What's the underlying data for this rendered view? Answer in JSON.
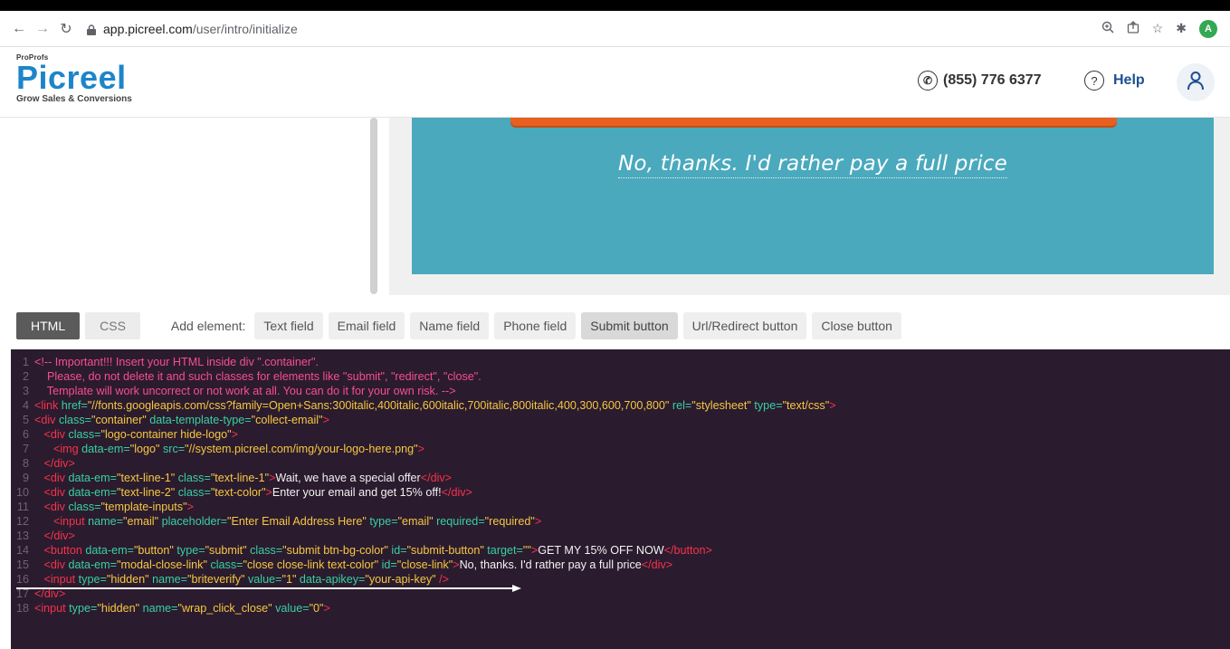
{
  "browser": {
    "url_host": "app.picreel.com",
    "url_path": "/user/intro/initialize",
    "profile_initial": "A"
  },
  "header": {
    "brand_small": "ProProfs",
    "brand_name": "Picreel",
    "brand_tagline": "Grow Sales & Conversions",
    "phone": "(855) 776 6377",
    "help_label": "Help"
  },
  "preview": {
    "decline_text": "No, thanks. I'd rather pay a full price"
  },
  "toolbar": {
    "tabs": [
      {
        "label": "HTML",
        "active": true
      },
      {
        "label": "CSS",
        "active": false
      }
    ],
    "add_element_label": "Add element:",
    "elements": [
      "Text field",
      "Email field",
      "Name field",
      "Phone field",
      "Submit button",
      "Url/Redirect button",
      "Close button"
    ]
  },
  "code": {
    "lines": [
      [
        [
          "cmt",
          "<!-- Important!!! Insert your HTML inside div \".container\"."
        ]
      ],
      [
        [
          "cmt",
          "    Please, do not delete it and such classes for elements like \"submit\", \"redirect\", \"close\"."
        ]
      ],
      [
        [
          "cmt",
          "    Template will work uncorrect or not work at all. You can do it for your own risk. -->"
        ]
      ],
      [
        [
          "tag",
          "<link "
        ],
        [
          "attr",
          "href="
        ],
        [
          "val",
          "\"//fonts.googleapis.com/css?family=Open+Sans:300italic,400italic,600italic,700italic,800italic,400,300,600,700,800\""
        ],
        [
          "attr",
          " rel="
        ],
        [
          "val",
          "\"stylesheet\""
        ],
        [
          "attr",
          " type="
        ],
        [
          "val",
          "\"text/css\""
        ],
        [
          "tag",
          ">"
        ]
      ],
      [
        [
          "tag",
          "<div "
        ],
        [
          "attr",
          "class="
        ],
        [
          "val",
          "\"container\""
        ],
        [
          "attr",
          " data-template-type="
        ],
        [
          "val",
          "\"collect-email\""
        ],
        [
          "tag",
          ">"
        ]
      ],
      [
        [
          "txt",
          "   "
        ],
        [
          "tag",
          "<div "
        ],
        [
          "attr",
          "class="
        ],
        [
          "val",
          "\"logo-container hide-logo\""
        ],
        [
          "tag",
          ">"
        ]
      ],
      [
        [
          "txt",
          "      "
        ],
        [
          "tag",
          "<img "
        ],
        [
          "attr",
          "data-em="
        ],
        [
          "val",
          "\"logo\""
        ],
        [
          "attr",
          " src="
        ],
        [
          "val",
          "\"//system.picreel.com/img/your-logo-here.png\""
        ],
        [
          "tag",
          ">"
        ]
      ],
      [
        [
          "txt",
          "   "
        ],
        [
          "tag",
          "</div>"
        ]
      ],
      [
        [
          "txt",
          "   "
        ],
        [
          "tag",
          "<div "
        ],
        [
          "attr",
          "data-em="
        ],
        [
          "val",
          "\"text-line-1\""
        ],
        [
          "attr",
          " class="
        ],
        [
          "val",
          "\"text-line-1\""
        ],
        [
          "tag",
          ">"
        ],
        [
          "txt",
          "Wait, we have a special offer"
        ],
        [
          "tag",
          "</div>"
        ]
      ],
      [
        [
          "txt",
          "   "
        ],
        [
          "tag",
          "<div "
        ],
        [
          "attr",
          "data-em="
        ],
        [
          "val",
          "\"text-line-2\""
        ],
        [
          "attr",
          " class="
        ],
        [
          "val",
          "\"text-color\""
        ],
        [
          "tag",
          ">"
        ],
        [
          "txt",
          "Enter your email and get 15% off!"
        ],
        [
          "tag",
          "</div>"
        ]
      ],
      [
        [
          "txt",
          "   "
        ],
        [
          "tag",
          "<div "
        ],
        [
          "attr",
          "class="
        ],
        [
          "val",
          "\"template-inputs\""
        ],
        [
          "tag",
          ">"
        ]
      ],
      [
        [
          "txt",
          "      "
        ],
        [
          "tag",
          "<input "
        ],
        [
          "attr",
          "name="
        ],
        [
          "val",
          "\"email\""
        ],
        [
          "attr",
          " placeholder="
        ],
        [
          "val",
          "\"Enter Email Address Here\""
        ],
        [
          "attr",
          " type="
        ],
        [
          "val",
          "\"email\""
        ],
        [
          "attr",
          " required="
        ],
        [
          "val",
          "\"required\""
        ],
        [
          "tag",
          ">"
        ]
      ],
      [
        [
          "txt",
          "   "
        ],
        [
          "tag",
          "</div>"
        ]
      ],
      [
        [
          "txt",
          "   "
        ],
        [
          "tag",
          "<button "
        ],
        [
          "attr",
          "data-em="
        ],
        [
          "val",
          "\"button\""
        ],
        [
          "attr",
          " type="
        ],
        [
          "val",
          "\"submit\""
        ],
        [
          "attr",
          " class="
        ],
        [
          "val",
          "\"submit btn-bg-color\""
        ],
        [
          "attr",
          " id="
        ],
        [
          "val",
          "\"submit-button\""
        ],
        [
          "attr",
          " target="
        ],
        [
          "val",
          "\"\""
        ],
        [
          "tag",
          ">"
        ],
        [
          "txt",
          "GET MY 15% OFF NOW"
        ],
        [
          "tag",
          "</button>"
        ]
      ],
      [
        [
          "txt",
          "   "
        ],
        [
          "tag",
          "<div "
        ],
        [
          "attr",
          "data-em="
        ],
        [
          "val",
          "\"modal-close-link\""
        ],
        [
          "attr",
          " class="
        ],
        [
          "val",
          "\"close close-link text-color\""
        ],
        [
          "attr",
          " id="
        ],
        [
          "val",
          "\"close-link\""
        ],
        [
          "tag",
          ">"
        ],
        [
          "txt",
          "No, thanks. I'd rather pay a full price"
        ],
        [
          "tag",
          "</div>"
        ]
      ],
      [
        [
          "txt",
          "   "
        ],
        [
          "tag",
          "<input "
        ],
        [
          "attr",
          "type="
        ],
        [
          "val",
          "\"hidden\""
        ],
        [
          "attr",
          " name="
        ],
        [
          "val",
          "\"briteverify\""
        ],
        [
          "attr",
          " value="
        ],
        [
          "val",
          "\"1\""
        ],
        [
          "attr",
          " data-apikey="
        ],
        [
          "val",
          "\"your-api-key\""
        ],
        [
          "tag",
          " />"
        ]
      ],
      [
        [
          "tag",
          "</div>"
        ]
      ],
      [
        [
          "tag",
          "<input "
        ],
        [
          "attr",
          "type="
        ],
        [
          "val",
          "\"hidden\""
        ],
        [
          "attr",
          " name="
        ],
        [
          "val",
          "\"wrap_click_close\""
        ],
        [
          "attr",
          " value="
        ],
        [
          "val",
          "\"0\""
        ],
        [
          "tag",
          ">"
        ]
      ]
    ]
  },
  "colors": {
    "brand_blue": "#1d85c9",
    "preview_bg": "#4aa9bd",
    "cta_orange": "#e8601f",
    "editor_bg": "#2b1b2e"
  }
}
